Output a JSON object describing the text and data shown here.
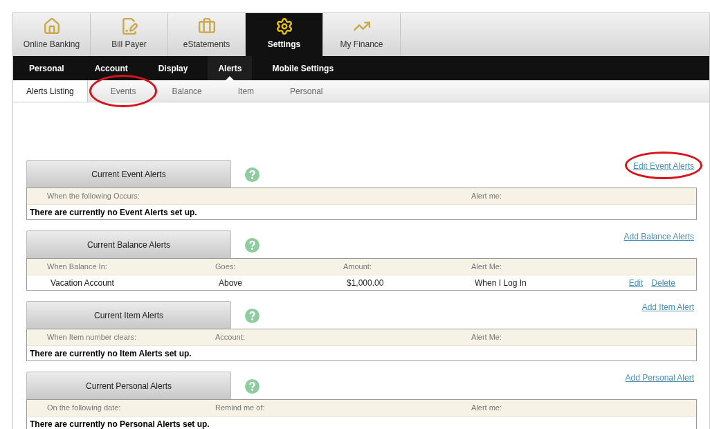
{
  "main_tabs": [
    {
      "label": "Online Banking",
      "selected": false
    },
    {
      "label": "Bill Payer",
      "selected": false
    },
    {
      "label": "eStatements",
      "selected": false
    },
    {
      "label": "Settings",
      "selected": true
    },
    {
      "label": "My Finance",
      "selected": false
    }
  ],
  "settings_nav": [
    {
      "label": "Personal",
      "selected": false
    },
    {
      "label": "Account",
      "selected": false
    },
    {
      "label": "Display",
      "selected": false
    },
    {
      "label": "Alerts",
      "selected": true
    },
    {
      "label": "Mobile Settings",
      "selected": false
    }
  ],
  "alerts_tabs": [
    {
      "label": "Alerts Listing",
      "selected": true,
      "circled": false
    },
    {
      "label": "Events",
      "selected": false,
      "circled": true
    },
    {
      "label": "Balance",
      "selected": false,
      "circled": false
    },
    {
      "label": "Item",
      "selected": false,
      "circled": false
    },
    {
      "label": "Personal",
      "selected": false,
      "circled": false
    }
  ],
  "sections": [
    {
      "title": "Current Event Alerts",
      "link": {
        "label": "Edit Event Alerts",
        "circled": true
      },
      "columns": [
        "When the following Occurs:",
        "Alert me:"
      ],
      "empty_message": "There are currently no Event Alerts set up."
    },
    {
      "title": "Current Balance Alerts",
      "link": {
        "label": "Add Balance Alerts",
        "circled": false
      },
      "columns": [
        "When Balance In:",
        "Goes:",
        "Amount:",
        "Alert Me:"
      ],
      "rows": [
        {
          "cells": [
            "Vacation Account",
            "Above",
            "$1,000.00",
            "When I Log In"
          ],
          "actions": [
            "Edit",
            "Delete"
          ]
        }
      ]
    },
    {
      "title": "Current Item Alerts",
      "link": {
        "label": "Add Item Alert",
        "circled": false
      },
      "columns": [
        "When Item number clears:",
        "Account:",
        "Alert Me:"
      ],
      "empty_message": "There are currently no Item Alerts set up."
    },
    {
      "title": "Current Personal Alerts",
      "link": {
        "label": "Add Personal Alert",
        "circled": false
      },
      "columns": [
        "On the following date:",
        "Remind me of:",
        "Alert me:"
      ],
      "empty_message": "There are currently no Personal Alerts set up."
    }
  ]
}
